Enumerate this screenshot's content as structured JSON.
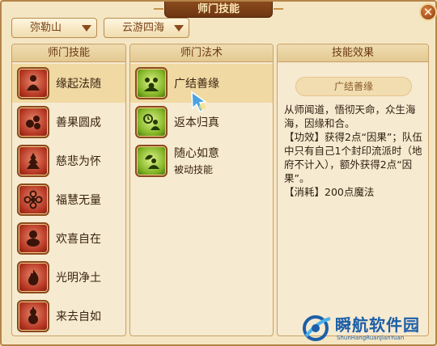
{
  "window": {
    "title": "师门技能",
    "close_label": "✕"
  },
  "filters": {
    "dropdown1": "弥勒山",
    "dropdown2": "云游四海"
  },
  "skills_panel": {
    "header": "师门技能",
    "items": [
      {
        "label": "缘起法随",
        "icon": "monk-seated-icon",
        "selected": true
      },
      {
        "label": "善果圆成",
        "icon": "fruits-icon",
        "selected": false
      },
      {
        "label": "慈悲为怀",
        "icon": "pagoda-icon",
        "selected": false
      },
      {
        "label": "福慧无量",
        "icon": "flower-icon",
        "selected": false
      },
      {
        "label": "欢喜自在",
        "icon": "laughing-buddha-icon",
        "selected": false
      },
      {
        "label": "光明净土",
        "icon": "flame-icon",
        "selected": false
      },
      {
        "label": "来去自如",
        "icon": "gourd-icon",
        "selected": false
      }
    ]
  },
  "arts_panel": {
    "header": "师门法术",
    "items": [
      {
        "label": "广结善缘",
        "sub": "",
        "icon": "group-icon",
        "selected": true
      },
      {
        "label": "返本归真",
        "sub": "",
        "icon": "clock-figure-icon",
        "selected": false
      },
      {
        "label": "随心如意",
        "sub": "被动技能",
        "icon": "leaf-figure-icon",
        "selected": false
      }
    ]
  },
  "effect_panel": {
    "header": "技能效果",
    "skill_name": "广结善缘",
    "description": [
      "从师闻道，悟彻天命，众生海海，因缘和合。",
      "【功效】获得2点“因果”；队伍中只有自己1个封印流派时（地府不计入），额外获得2点“因果”。",
      "【消耗】200点魔法"
    ]
  },
  "watermark": {
    "title": "瞬航软件园",
    "subtitle": "ShunHangRuanJianYuan"
  },
  "colors": {
    "accent": "#8a4a1c",
    "panel_bg": "#f6ead0",
    "selected_bg": "#f0d9a2"
  }
}
